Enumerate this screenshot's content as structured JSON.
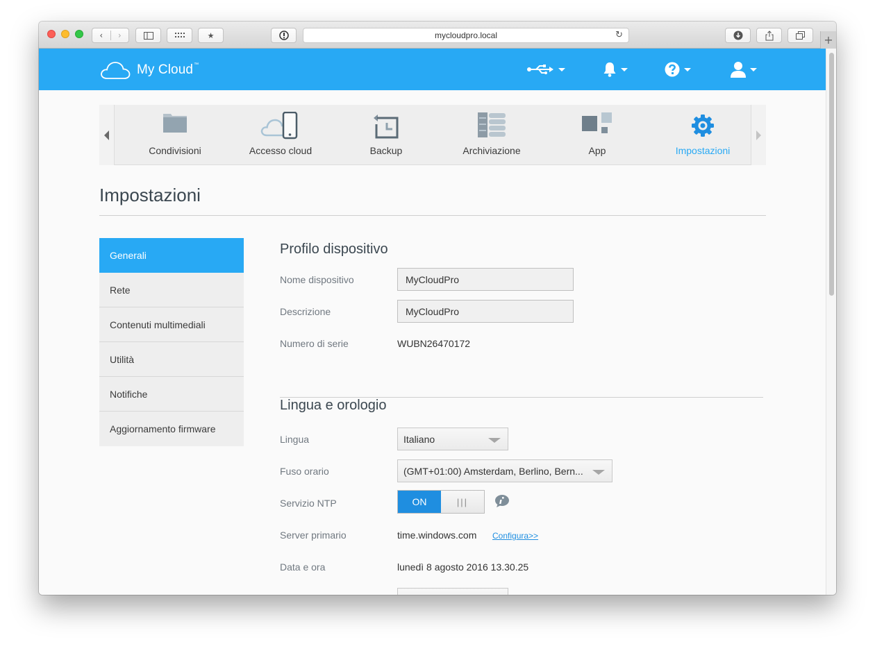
{
  "browser": {
    "url": "mycloudpro.local"
  },
  "app": {
    "brand": "My Cloud",
    "brand_tm": "™"
  },
  "mainnav": {
    "items": [
      {
        "label": "Condivisioni"
      },
      {
        "label": "Accesso cloud"
      },
      {
        "label": "Backup"
      },
      {
        "label": "Archiviazione"
      },
      {
        "label": "App"
      },
      {
        "label": "Impostazioni"
      }
    ],
    "active_index": 5
  },
  "page": {
    "title": "Impostazioni"
  },
  "sidemenu": {
    "items": [
      {
        "label": "Generali"
      },
      {
        "label": "Rete"
      },
      {
        "label": "Contenuti multimediali"
      },
      {
        "label": "Utilità"
      },
      {
        "label": "Notifiche"
      },
      {
        "label": "Aggiornamento firmware"
      }
    ]
  },
  "profile": {
    "title": "Profilo dispositivo",
    "device_name_label": "Nome dispositivo",
    "device_name_value": "MyCloudPro",
    "description_label": "Descrizione",
    "description_value": "MyCloudPro",
    "serial_label": "Numero di serie",
    "serial_value": "WUBN26470172"
  },
  "language_clock": {
    "title": "Lingua e orologio",
    "language_label": "Lingua",
    "language_value": "Italiano",
    "timezone_label": "Fuso orario",
    "timezone_value": "(GMT+01:00) Amsterdam, Berlino, Bern...",
    "ntp_label": "Servizio NTP",
    "ntp_on": "ON",
    "ntp_off": "|||",
    "primary_server_label": "Server primario",
    "primary_server_value": "time.windows.com",
    "configure_link": "Configura>>",
    "datetime_label": "Data e ora",
    "datetime_value": "lunedì 8 agosto 2016 13.30.25"
  },
  "colors": {
    "accent": "#28a9f4",
    "toggle_on": "#1f8ee0",
    "sidebar_bg": "#eeeeee"
  }
}
